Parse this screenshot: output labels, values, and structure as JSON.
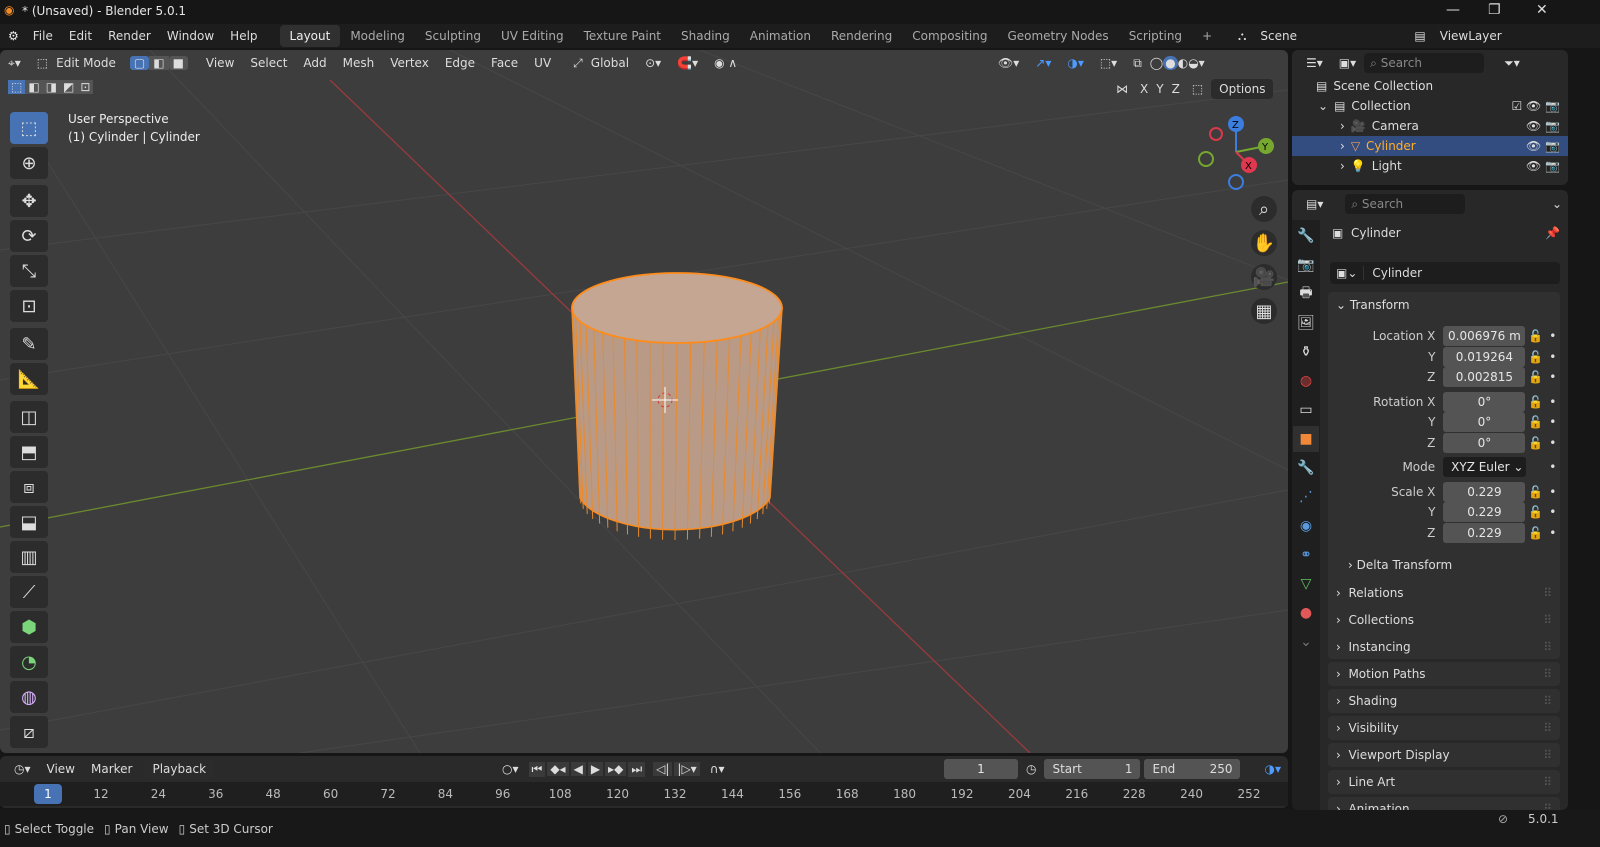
{
  "window": {
    "title": "* (Unsaved) - Blender 5.0.1",
    "minimize": "—",
    "maximize": "❐",
    "close": "✕"
  },
  "menu": [
    "File",
    "Edit",
    "Render",
    "Window",
    "Help"
  ],
  "workspaces": [
    "Layout",
    "Modeling",
    "Sculpting",
    "UV Editing",
    "Texture Paint",
    "Shading",
    "Animation",
    "Rendering",
    "Compositing",
    "Geometry Nodes",
    "Scripting",
    "+"
  ],
  "scene": "Scene",
  "view_layer": "ViewLayer",
  "viewport": {
    "mode": "Edit Mode",
    "menus": [
      "View",
      "Select",
      "Add",
      "Mesh",
      "Vertex",
      "Edge",
      "Face",
      "UV"
    ],
    "orientation": "Global",
    "options": "Options",
    "axes": [
      "X",
      "Y",
      "Z"
    ],
    "info_line1": "User Perspective",
    "info_line2": "(1) Cylinder | Cylinder",
    "gizmo": {
      "z": "Z",
      "y": "Y",
      "x": "X"
    }
  },
  "outliner": {
    "search_placeholder": "Search",
    "items": [
      {
        "label": "Scene Collection"
      },
      {
        "label": "Collection"
      },
      {
        "label": "Camera"
      },
      {
        "label": "Cylinder"
      },
      {
        "label": "Light"
      }
    ]
  },
  "properties": {
    "search_placeholder": "Search",
    "object_name": "Cylinder",
    "data_name": "Cylinder",
    "transform": "Transform",
    "location_label": "Location X",
    "location": [
      "0.006976 m",
      "0.019264",
      "0.002815"
    ],
    "rotation_label": "Rotation X",
    "rotation": [
      "0°",
      "0°",
      "0°"
    ],
    "mode_label": "Mode",
    "mode": "XYZ Euler",
    "scale_label": "Scale X",
    "scale": [
      "0.229",
      "0.229",
      "0.229"
    ],
    "axis_y": "Y",
    "axis_z": "Z",
    "delta": "Delta Transform",
    "panels": [
      "Relations",
      "Collections",
      "Instancing",
      "Motion Paths",
      "Shading",
      "Visibility",
      "Viewport Display",
      "Line Art",
      "Animation"
    ]
  },
  "timeline": {
    "menus": [
      "View",
      "Marker",
      "Playback"
    ],
    "current_frame": "1",
    "start_label": "Start",
    "start": "1",
    "end_label": "End",
    "end": "250",
    "ruler": [
      "1",
      "12",
      "24",
      "36",
      "48",
      "60",
      "72",
      "84",
      "96",
      "108",
      "120",
      "132",
      "144",
      "156",
      "168",
      "180",
      "192",
      "204",
      "216",
      "228",
      "240",
      "252"
    ]
  },
  "status": {
    "items": [
      "Select Toggle",
      "Pan View",
      "Set 3D Cursor"
    ],
    "version": "5.0.1"
  },
  "colors": {
    "accent": "#4772b3",
    "selection": "#ff8c1a",
    "x_axis": "#c9393c",
    "y_axis": "#76a82f"
  }
}
